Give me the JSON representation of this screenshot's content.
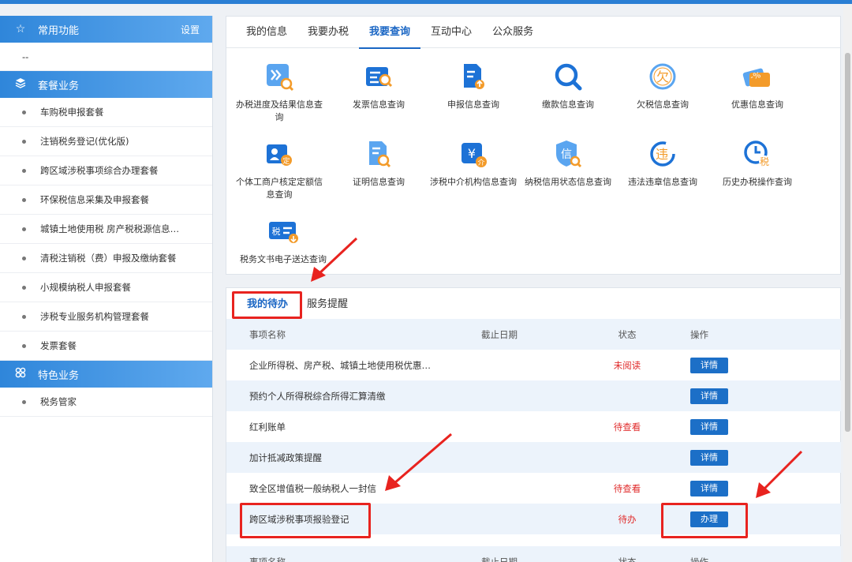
{
  "sidebar": {
    "common": {
      "title": "常用功能",
      "setting": "设置",
      "empty": "--"
    },
    "package": {
      "title": "套餐业务",
      "items": [
        "车购税申报套餐",
        "注销税务登记(优化版)",
        "跨区域涉税事项综合办理套餐",
        "环保税信息采集及申报套餐",
        "城镇土地使用税 房产税税源信息…",
        "清税注销税（费）申报及缴纳套餐",
        "小规模纳税人申报套餐",
        "涉税专业服务机构管理套餐",
        "发票套餐"
      ]
    },
    "special": {
      "title": "特色业务",
      "items": [
        "税务管家"
      ]
    }
  },
  "tabs": [
    "我的信息",
    "我要办税",
    "我要查询",
    "互动中心",
    "公众服务"
  ],
  "active_tab": "我要查询",
  "query_items": [
    {
      "label": "办税进度及结果信息查询",
      "icon": "progress-search-icon"
    },
    {
      "label": "发票信息查询",
      "icon": "invoice-search-icon"
    },
    {
      "label": "申报信息查询",
      "icon": "declaration-icon"
    },
    {
      "label": "缴款信息查询",
      "icon": "magnifier-icon"
    },
    {
      "label": "欠税信息查询",
      "icon": "arrears-icon"
    },
    {
      "label": "优惠信息查询",
      "icon": "discount-icon"
    },
    {
      "label": "个体工商户核定定额信息查询",
      "icon": "individual-business-icon"
    },
    {
      "label": "证明信息查询",
      "icon": "certificate-icon"
    },
    {
      "label": "涉税中介机构信息查询",
      "icon": "agency-icon"
    },
    {
      "label": "纳税信用状态信息查询",
      "icon": "credit-icon"
    },
    {
      "label": "违法违章信息查询",
      "icon": "violation-icon"
    },
    {
      "label": "历史办税操作查询",
      "icon": "history-icon"
    },
    {
      "label": "税务文书电子送达查询",
      "icon": "tax-document-icon"
    }
  ],
  "todo": {
    "tabs": [
      "我的待办",
      "服务提醒"
    ],
    "headers": {
      "name": "事项名称",
      "deadline": "截止日期",
      "status": "状态",
      "action": "操作"
    },
    "rows": [
      {
        "name": "企业所得税、房产税、城镇土地使用税优惠…",
        "deadline": "",
        "status": "未阅读",
        "action": "详情"
      },
      {
        "name": "预约个人所得税综合所得汇算清缴",
        "deadline": "",
        "status": "",
        "action": "详情"
      },
      {
        "name": "红利账单",
        "deadline": "",
        "status": "待查看",
        "action": "详情"
      },
      {
        "name": "加计抵减政策提醒",
        "deadline": "",
        "status": "",
        "action": "详情"
      },
      {
        "name": "致全区增值税一般纳税人一封信",
        "deadline": "",
        "status": "待查看",
        "action": "详情"
      },
      {
        "name": "跨区域涉税事项报验登记",
        "deadline": "",
        "status": "待办",
        "action": "办理"
      }
    ]
  },
  "colors": {
    "accent": "#1a66c4",
    "annotation": "#e8231f",
    "status_red": "#e02b2b"
  }
}
